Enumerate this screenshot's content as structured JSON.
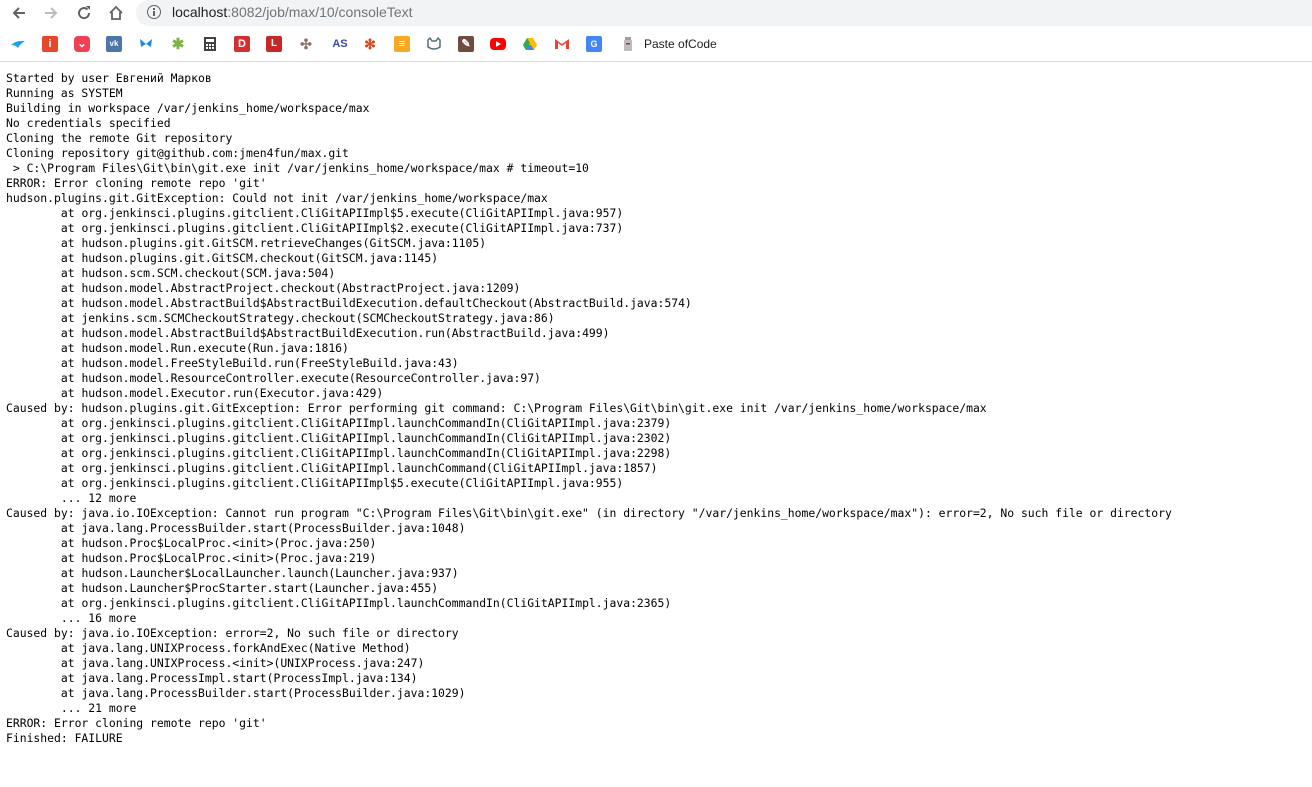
{
  "browser": {
    "back_icon": "arrow-left-icon",
    "forward_icon": "arrow-right-icon",
    "reload_icon": "reload-icon",
    "home_icon": "home-icon",
    "address": {
      "host": "localhost",
      "path": ":8082/job/max/10/consoleText"
    }
  },
  "bookmarks": {
    "items": [
      {
        "icon": "bird-icon",
        "color": "#1da1f2"
      },
      {
        "icon": "i-square-icon",
        "color": "#e8462b"
      },
      {
        "icon": "pocket-icon",
        "color": "#ef4056"
      },
      {
        "icon": "vk-icon",
        "color": "#4a76a8"
      },
      {
        "icon": "butterfly-icon",
        "color": "#1e88e5"
      },
      {
        "icon": "star-icon",
        "color": "#7cb342"
      },
      {
        "icon": "calculator-icon",
        "color": "#424242"
      },
      {
        "icon": "d-icon",
        "color": "#d32f2f"
      },
      {
        "icon": "book-icon",
        "color": "#c62828"
      },
      {
        "icon": "windmill-icon",
        "color": "#8d6e63"
      },
      {
        "icon": "as-icon",
        "color": "#3949ab"
      },
      {
        "icon": "spider-icon",
        "color": "#d84315"
      },
      {
        "icon": "notepad-icon",
        "color": "#f9a825"
      },
      {
        "icon": "cat-icon",
        "color": "#546e7a"
      },
      {
        "icon": "wrench-icon",
        "color": "#6d4c41"
      },
      {
        "icon": "youtube-icon",
        "color": "#ff0000"
      },
      {
        "icon": "drive-icon",
        "color": "#34a853"
      },
      {
        "icon": "gmail-icon",
        "color": "#ea4335"
      },
      {
        "icon": "translate-icon",
        "color": "#4285f4"
      },
      {
        "icon": "paste-of-code-icon",
        "color": "#9e9e9e"
      }
    ],
    "last_label": "Paste ofCode"
  },
  "console": {
    "text": "Started by user Евгений Марков\nRunning as SYSTEM\nBuilding in workspace /var/jenkins_home/workspace/max\nNo credentials specified\nCloning the remote Git repository\nCloning repository git@github.com:jmen4fun/max.git\n > C:\\Program Files\\Git\\bin\\git.exe init /var/jenkins_home/workspace/max # timeout=10\nERROR: Error cloning remote repo 'git'\nhudson.plugins.git.GitException: Could not init /var/jenkins_home/workspace/max\n\tat org.jenkinsci.plugins.gitclient.CliGitAPIImpl$5.execute(CliGitAPIImpl.java:957)\n\tat org.jenkinsci.plugins.gitclient.CliGitAPIImpl$2.execute(CliGitAPIImpl.java:737)\n\tat hudson.plugins.git.GitSCM.retrieveChanges(GitSCM.java:1105)\n\tat hudson.plugins.git.GitSCM.checkout(GitSCM.java:1145)\n\tat hudson.scm.SCM.checkout(SCM.java:504)\n\tat hudson.model.AbstractProject.checkout(AbstractProject.java:1209)\n\tat hudson.model.AbstractBuild$AbstractBuildExecution.defaultCheckout(AbstractBuild.java:574)\n\tat jenkins.scm.SCMCheckoutStrategy.checkout(SCMCheckoutStrategy.java:86)\n\tat hudson.model.AbstractBuild$AbstractBuildExecution.run(AbstractBuild.java:499)\n\tat hudson.model.Run.execute(Run.java:1816)\n\tat hudson.model.FreeStyleBuild.run(FreeStyleBuild.java:43)\n\tat hudson.model.ResourceController.execute(ResourceController.java:97)\n\tat hudson.model.Executor.run(Executor.java:429)\nCaused by: hudson.plugins.git.GitException: Error performing git command: C:\\Program Files\\Git\\bin\\git.exe init /var/jenkins_home/workspace/max\n\tat org.jenkinsci.plugins.gitclient.CliGitAPIImpl.launchCommandIn(CliGitAPIImpl.java:2379)\n\tat org.jenkinsci.plugins.gitclient.CliGitAPIImpl.launchCommandIn(CliGitAPIImpl.java:2302)\n\tat org.jenkinsci.plugins.gitclient.CliGitAPIImpl.launchCommandIn(CliGitAPIImpl.java:2298)\n\tat org.jenkinsci.plugins.gitclient.CliGitAPIImpl.launchCommand(CliGitAPIImpl.java:1857)\n\tat org.jenkinsci.plugins.gitclient.CliGitAPIImpl$5.execute(CliGitAPIImpl.java:955)\n\t... 12 more\nCaused by: java.io.IOException: Cannot run program \"C:\\Program Files\\Git\\bin\\git.exe\" (in directory \"/var/jenkins_home/workspace/max\"): error=2, No such file or directory\n\tat java.lang.ProcessBuilder.start(ProcessBuilder.java:1048)\n\tat hudson.Proc$LocalProc.<init>(Proc.java:250)\n\tat hudson.Proc$LocalProc.<init>(Proc.java:219)\n\tat hudson.Launcher$LocalLauncher.launch(Launcher.java:937)\n\tat hudson.Launcher$ProcStarter.start(Launcher.java:455)\n\tat org.jenkinsci.plugins.gitclient.CliGitAPIImpl.launchCommandIn(CliGitAPIImpl.java:2365)\n\t... 16 more\nCaused by: java.io.IOException: error=2, No such file or directory\n\tat java.lang.UNIXProcess.forkAndExec(Native Method)\n\tat java.lang.UNIXProcess.<init>(UNIXProcess.java:247)\n\tat java.lang.ProcessImpl.start(ProcessImpl.java:134)\n\tat java.lang.ProcessBuilder.start(ProcessBuilder.java:1029)\n\t... 21 more\nERROR: Error cloning remote repo 'git'\nFinished: FAILURE"
  }
}
